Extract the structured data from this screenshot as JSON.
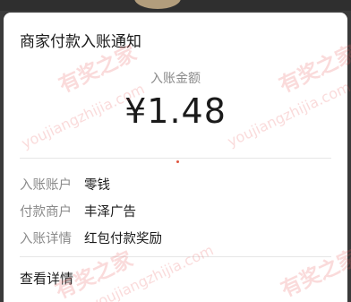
{
  "notification": {
    "title": "商家付款入账通知",
    "amount_label": "入账金额",
    "amount": "¥1.48",
    "rows": [
      {
        "key": "入账账户",
        "value": "零钱"
      },
      {
        "key": "付款商户",
        "value": "丰泽广告"
      },
      {
        "key": "入账详情",
        "value": "红包付款奖励"
      }
    ],
    "view_details": "查看详情"
  },
  "watermark": {
    "brand": "有奖之家",
    "url": "youjiangzhijia.com"
  }
}
